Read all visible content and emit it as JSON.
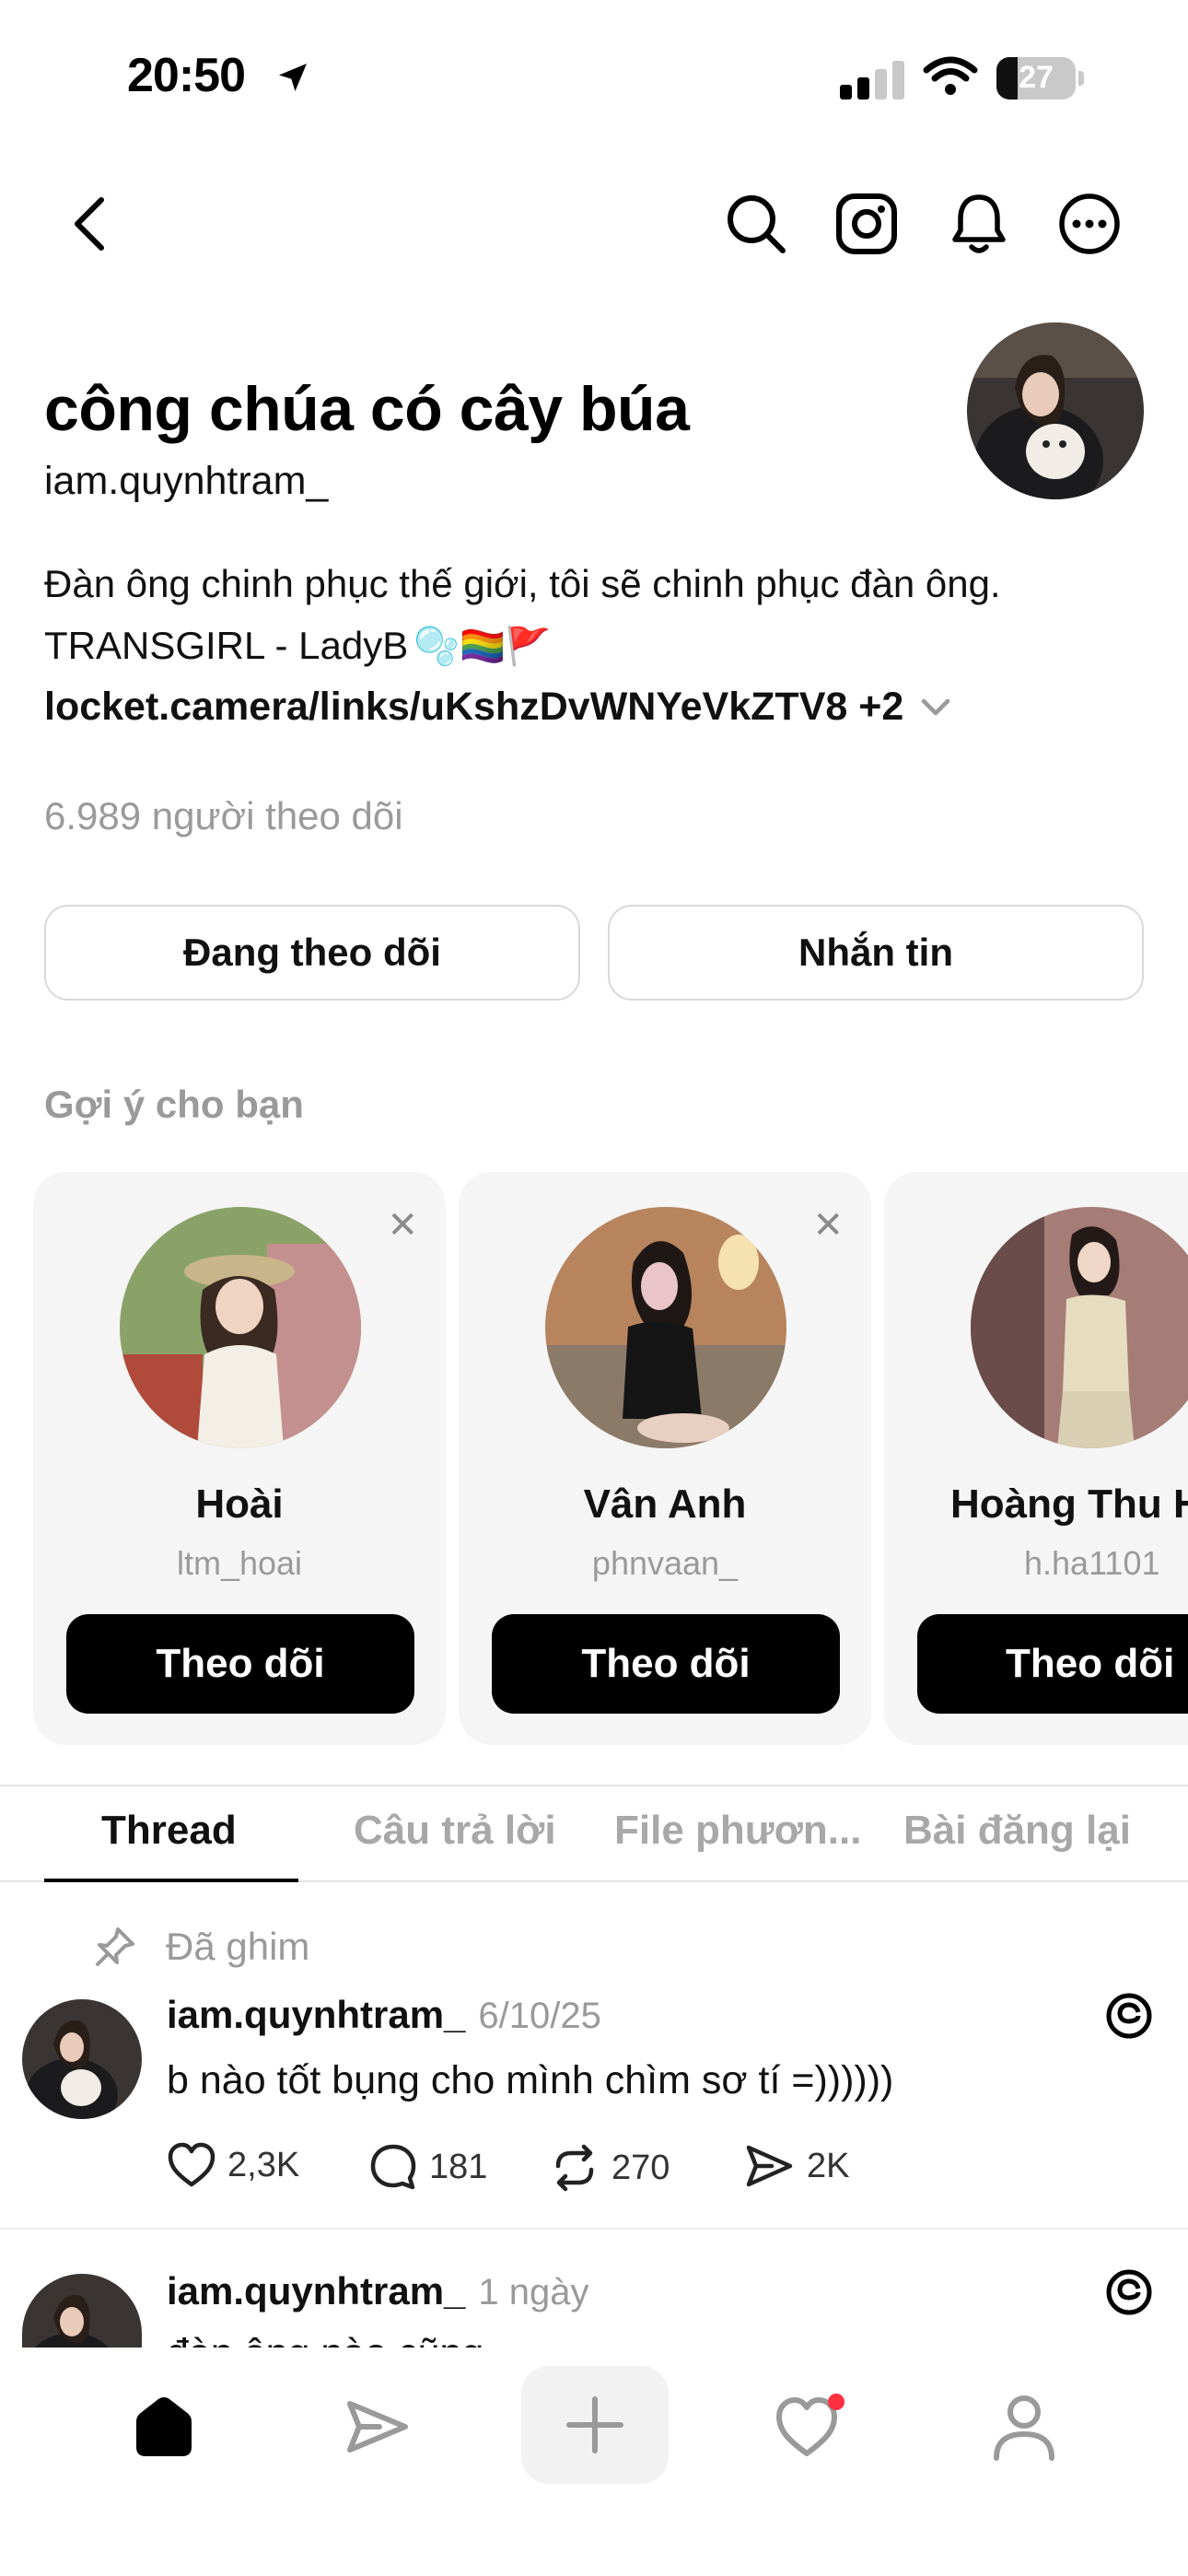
{
  "status_bar": {
    "time": "20:50",
    "battery": "27",
    "battery_level": 0.27
  },
  "header": {
    "icons": [
      "back-arrow-icon",
      "search-icon",
      "instagram-icon",
      "bell-icon",
      "more-options-icon"
    ]
  },
  "profile": {
    "name": "công chúa có cây búa",
    "handle": "iam.quynhtram_",
    "bio_line1": "Đàn ông chinh phục thế giới, tôi sẽ chinh phục đàn ông.",
    "bio_line2": "TRANSGIRL - LadyB",
    "bio_emojis": "🫧🏳️‍🌈🚩",
    "link": "locket.camera/links/uKshzDvWNYeVkZTV8 +2",
    "followers": "6.989 người theo dõi",
    "following_button": "Đang theo dõi",
    "message_button": "Nhắn tin"
  },
  "suggestions": {
    "title": "Gợi ý cho bạn",
    "close_glyph": "✕",
    "items": [
      {
        "name": "Hoài",
        "handle": "ltm_hoai",
        "button": "Theo dõi"
      },
      {
        "name": "Vân Anh",
        "handle": "phnvaan_",
        "button": "Theo dõi"
      },
      {
        "name": "Hoàng Thu H",
        "handle": "h.ha1101",
        "button": "Theo dõi"
      }
    ]
  },
  "tabs": [
    "Thread",
    "Câu trả lời",
    "File phươn...",
    "Bài đăng lại"
  ],
  "posts": [
    {
      "pinned_label": "Đã ghim",
      "username": "iam.quynhtram_",
      "time": "6/10/25",
      "text": "b nào tốt bụng cho mình chìm sơ tí =))))))",
      "likes": "2,3K",
      "replies": "181",
      "reposts": "270",
      "shares": "2K"
    },
    {
      "username": "iam.quynhtram_",
      "time": "1 ngày",
      "text": "đàn ông nào cũng chỉ nghĩ về"
    }
  ],
  "tab_bar": [
    "home-icon",
    "send-icon",
    "compose-icon",
    "activity-icon",
    "profile-icon"
  ],
  "colors": {
    "accent": "#000000",
    "muted": "#9a9a9a",
    "notification": "#ff3040"
  }
}
